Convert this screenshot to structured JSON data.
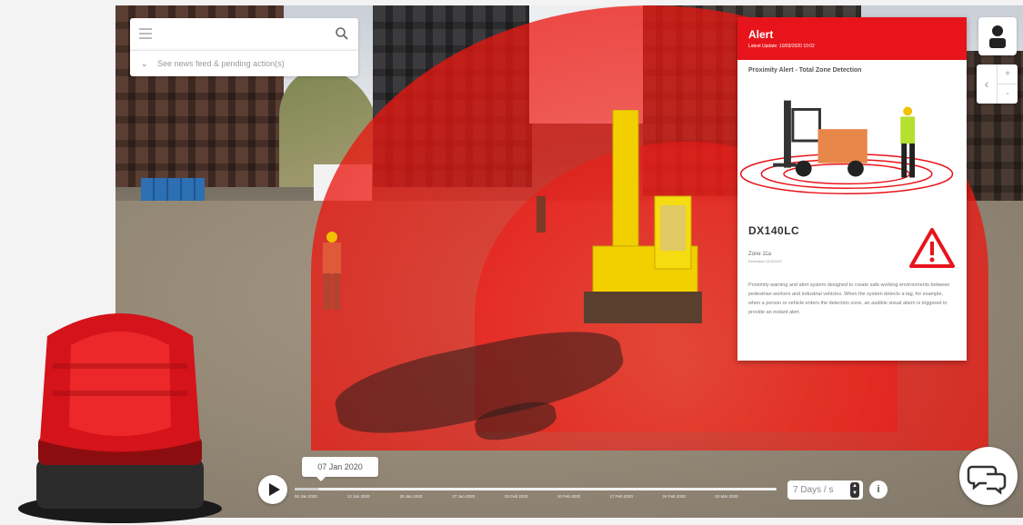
{
  "search": {
    "placeholder": ""
  },
  "newsfeed": {
    "label": "See news feed & pending action(s)"
  },
  "alert": {
    "title": "Alert",
    "updated": "Latest Update: 10/03/2020 10:02",
    "subtitle": "Proximity Alert - Total Zone Detection",
    "model": "DX140LC",
    "zone": "Zone 11a",
    "zone_meta": "Estimated 12/3/2020",
    "description": "Proximity warning and alert system designed to create safe working environments between pedestrian workers and industrial vehicles. When the system detects a tag, for example, when a person or vehicle enters the detection zone, an audible visual alarm is triggered to provide an instant alert."
  },
  "timeline": {
    "current_date": "07 Jan 2020",
    "progress": 0.05,
    "ticks": [
      "06 Jan 2020",
      "13 Jan 2020",
      "20 Jan 2020",
      "27 Jan 2020",
      "03 Feb 2020",
      "10 Feb 2020",
      "17 Feb 2020",
      "24 Feb 2020",
      "02 Mar 2020"
    ],
    "speed": "7 Days / s"
  },
  "controls": {
    "zoom_in": "+",
    "zoom_out": "-",
    "back": "‹",
    "info": "i"
  },
  "colors": {
    "alert_red": "#e8141b",
    "zone_red": "#ff1a10",
    "machine_yellow": "#f2d000"
  },
  "icons": {
    "menu": "hamburger-icon",
    "search": "search-icon",
    "user": "user-icon",
    "play": "play-icon",
    "chat": "chat-bubbles-icon",
    "warning": "warning-triangle-icon"
  }
}
